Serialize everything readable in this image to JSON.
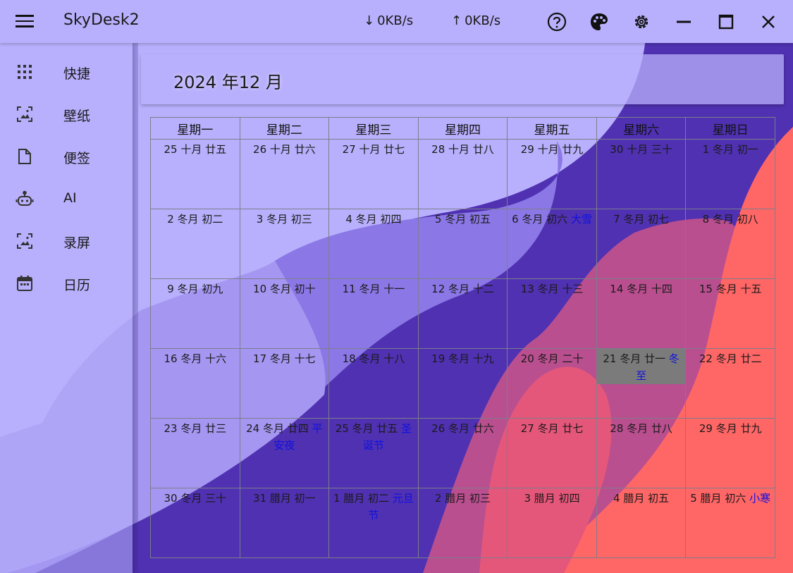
{
  "app": {
    "title": "SkyDesk2",
    "download_speed": "0KB/s",
    "upload_speed": "0KB/s",
    "icons": [
      "menu-icon",
      "arrow-down-icon",
      "arrow-up-icon",
      "help-icon",
      "palette-icon",
      "gear-icon",
      "minimize-icon",
      "maximize-icon",
      "close-icon"
    ]
  },
  "colors": {
    "titlebar": "#b8b0fc",
    "background_dark": "#4f31b1",
    "wave_mid": "#8b78e6",
    "wave_coral": "#ff6666",
    "solar_term_text": "#1010e0",
    "today_highlight": "#7b7b7b"
  },
  "sidebar": {
    "items": [
      {
        "label": "快捷",
        "icon": "grid-icon"
      },
      {
        "label": "壁纸",
        "icon": "wallpaper-icon"
      },
      {
        "label": "便签",
        "icon": "note-icon"
      },
      {
        "label": "AI",
        "icon": "robot-icon"
      },
      {
        "label": "录屏",
        "icon": "screen-record-icon"
      },
      {
        "label": "日历",
        "icon": "calendar-icon"
      }
    ]
  },
  "calendar": {
    "month_title": "2024 年12 月",
    "weekdays": [
      "星期一",
      "星期二",
      "星期三",
      "星期四",
      "星期五",
      "星期六",
      "星期日"
    ],
    "today_index": 26,
    "days": [
      {
        "text": "25 十月 廿五",
        "term": ""
      },
      {
        "text": "26 十月 廿六",
        "term": ""
      },
      {
        "text": "27 十月 廿七",
        "term": ""
      },
      {
        "text": "28 十月 廿八",
        "term": ""
      },
      {
        "text": "29 十月 廿九",
        "term": ""
      },
      {
        "text": "30 十月 三十",
        "term": ""
      },
      {
        "text": "1 冬月 初一",
        "term": ""
      },
      {
        "text": "2 冬月 初二",
        "term": ""
      },
      {
        "text": "3 冬月 初三",
        "term": ""
      },
      {
        "text": "4 冬月 初四",
        "term": ""
      },
      {
        "text": "5 冬月 初五",
        "term": ""
      },
      {
        "text": "6 冬月 初六",
        "term": "大雪"
      },
      {
        "text": "7 冬月 初七",
        "term": ""
      },
      {
        "text": "8 冬月 初八",
        "term": ""
      },
      {
        "text": "9 冬月 初九",
        "term": ""
      },
      {
        "text": "10 冬月 初十",
        "term": ""
      },
      {
        "text": "11 冬月 十一",
        "term": ""
      },
      {
        "text": "12 冬月 十二",
        "term": ""
      },
      {
        "text": "13 冬月 十三",
        "term": ""
      },
      {
        "text": "14 冬月 十四",
        "term": ""
      },
      {
        "text": "15 冬月 十五",
        "term": ""
      },
      {
        "text": "16 冬月 十六",
        "term": ""
      },
      {
        "text": "17 冬月 十七",
        "term": ""
      },
      {
        "text": "18 冬月 十八",
        "term": ""
      },
      {
        "text": "19 冬月 十九",
        "term": ""
      },
      {
        "text": "20 冬月 二十",
        "term": ""
      },
      {
        "text": "21 冬月 廿一",
        "term": "冬至"
      },
      {
        "text": "22 冬月 廿二",
        "term": ""
      },
      {
        "text": "23 冬月 廿三",
        "term": ""
      },
      {
        "text": "24 冬月 廿四",
        "term": "平安夜"
      },
      {
        "text": "25 冬月 廿五",
        "term": "圣诞节"
      },
      {
        "text": "26 冬月 廿六",
        "term": ""
      },
      {
        "text": "27 冬月 廿七",
        "term": ""
      },
      {
        "text": "28 冬月 廿八",
        "term": ""
      },
      {
        "text": "29 冬月 廿九",
        "term": ""
      },
      {
        "text": "30 冬月 三十",
        "term": ""
      },
      {
        "text": "31 腊月 初一",
        "term": ""
      },
      {
        "text": "1 腊月 初二",
        "term": "元旦节"
      },
      {
        "text": "2 腊月 初三",
        "term": ""
      },
      {
        "text": "3 腊月 初四",
        "term": ""
      },
      {
        "text": "4 腊月 初五",
        "term": ""
      },
      {
        "text": "5 腊月 初六",
        "term": "小寒"
      }
    ]
  }
}
